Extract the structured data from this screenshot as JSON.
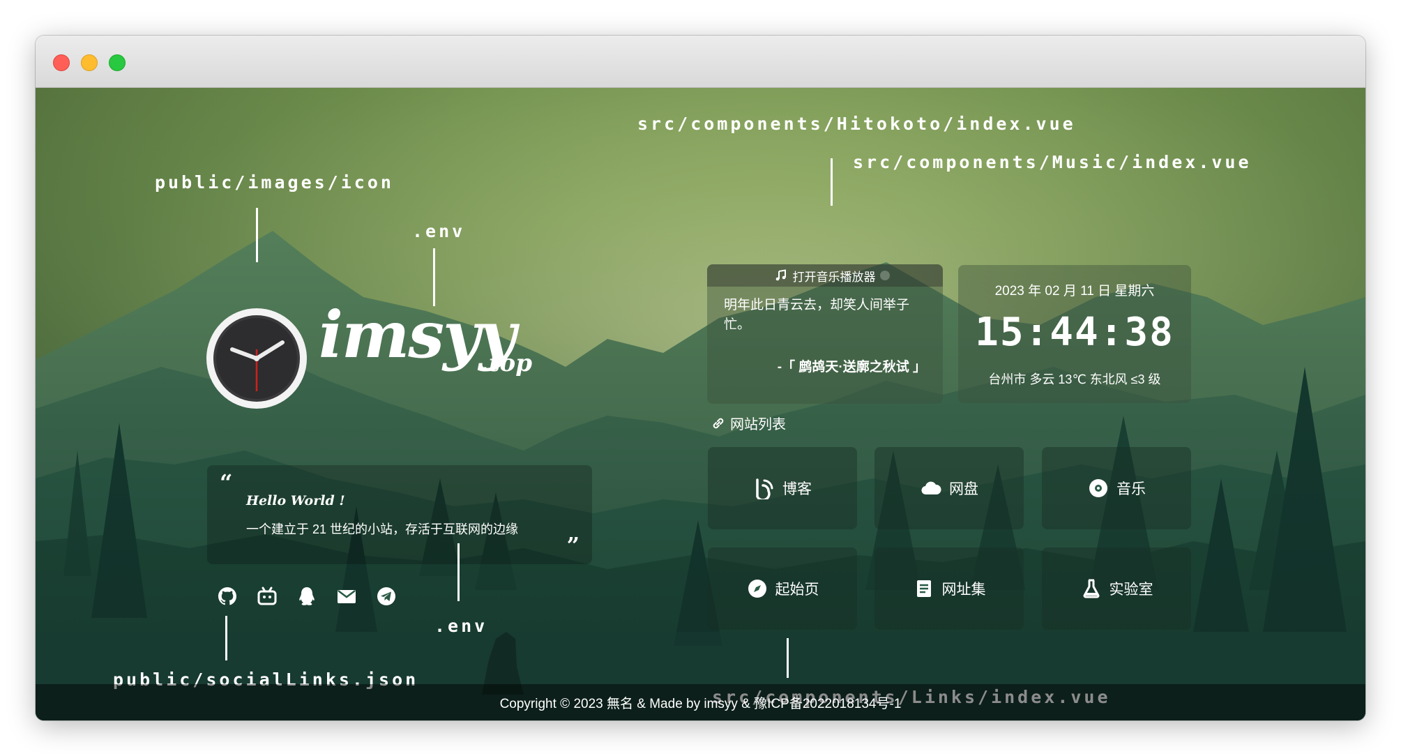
{
  "annotations": {
    "hitokoto_path": "src/components/Hitokoto/index.vue",
    "music_path": "src/components/Music/index.vue",
    "icon_path": "public/images/icon",
    "env_logo": ".env",
    "env_desc": ".env",
    "social_path": "public/socialLinks.json",
    "links_path": "src/components/Links/index.vue"
  },
  "logo": {
    "name": "imsyy",
    "tld": ".top"
  },
  "description": {
    "hello": "Hello World !",
    "text": "一个建立于 21 世纪的小站，存活于互联网的边缘"
  },
  "social_icons": [
    "github-icon",
    "bilibili-icon",
    "qq-icon",
    "email-icon",
    "telegram-icon"
  ],
  "music": {
    "toggle_label": "打开音乐播放器",
    "hitokoto_text": "明年此日青云去，却笑人间举子忙。",
    "hitokoto_from": "-「 鹧鸪天·送廓之秋试 」"
  },
  "time": {
    "date": "2023 年 02 月 11 日 星期六",
    "clock": "15:44:38",
    "weather": "台州市 多云 13℃ 东北风 ≤3 级"
  },
  "links": {
    "title": "网站列表",
    "items": [
      {
        "label": "博客",
        "icon": "blog-icon"
      },
      {
        "label": "网盘",
        "icon": "cloud-icon"
      },
      {
        "label": "音乐",
        "icon": "music-disc-icon"
      },
      {
        "label": "起始页",
        "icon": "compass-icon"
      },
      {
        "label": "网址集",
        "icon": "document-icon"
      },
      {
        "label": "实验室",
        "icon": "flask-icon"
      }
    ]
  },
  "footer": {
    "copyright": "Copyright © 2023 無名 & Made by imsyy & 豫ICP备2022018134号-1"
  },
  "colors": {
    "accent_light": "#d6e3a0",
    "forest_dark": "#173a33",
    "panel_tint": "#3c503c"
  }
}
